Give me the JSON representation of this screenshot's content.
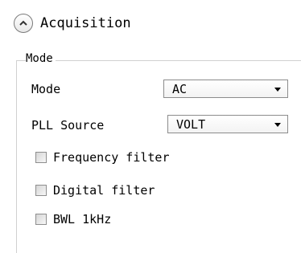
{
  "section": {
    "title": "Acquisition",
    "toggle_icon": "chevron-up-icon"
  },
  "group": {
    "legend": "Mode"
  },
  "fields": {
    "mode": {
      "label": "Mode",
      "value": "AC"
    },
    "pll_source": {
      "label": "PLL Source",
      "value": "VOLT"
    }
  },
  "filters": {
    "frequency_filter": {
      "label": "Frequency filter",
      "checked": false
    },
    "digital_filter": {
      "label": "Digital filter",
      "checked": false
    },
    "bwl_1khz": {
      "label": "BWL 1kHz",
      "checked": false
    }
  }
}
